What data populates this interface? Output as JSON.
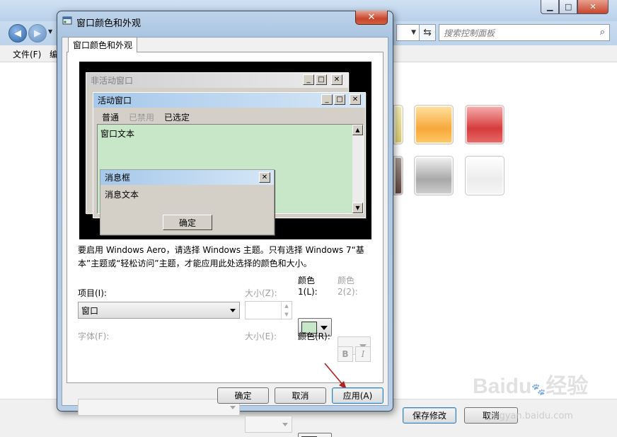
{
  "background": {
    "nav": {
      "back_icon": "back-arrow",
      "forward_icon": "forward-arrow"
    },
    "search": {
      "placeholder": "搜索控制面板",
      "icon": "search-icon"
    },
    "menu": {
      "file": "文件(F)",
      "edit": "编"
    },
    "bottom": {
      "save_label": "保存修改",
      "cancel_label": "取消"
    },
    "watermark": {
      "brand": "Baidu",
      "cn": "经验",
      "url": "jingyan.baidu.com"
    }
  },
  "dialog": {
    "title": "窗口颜色和外观",
    "close_label": "✕",
    "tab_label": "窗口颜色和外观",
    "preview": {
      "inactive_title": "非活动窗口",
      "active_title": "活动窗口",
      "menu": {
        "normal": "普通",
        "disabled": "已禁用",
        "selected": "已选定"
      },
      "window_text": "窗口文本",
      "msgbox_title": "消息框",
      "msgbox_text": "消息文本",
      "msgbox_ok": "确定"
    },
    "info_text": "要启用 Windows Aero，请选择 Windows 主题。只有选择 Windows 7“基本”主题或“轻松访问”主题，才能应用此处选择的颜色和大小。",
    "form": {
      "item_label": "项目(I):",
      "item_value": "窗口",
      "size_label": "大小(Z):",
      "color1_label_a": "颜色",
      "color1_label_b": "1(L):",
      "color2_label_a": "颜色",
      "color2_label_b": "2(2):",
      "font_label": "字体(F):",
      "font_size_label": "大小(E):",
      "font_color_label": "颜色(R):",
      "bold_label": "B",
      "italic_label": "I"
    },
    "buttons": {
      "ok": "确定",
      "cancel": "取消",
      "apply": "应用(A)"
    },
    "colors": {
      "color1": "#c8e6c8",
      "font_color": "#000000",
      "accent_arrow": "#b22222"
    }
  }
}
